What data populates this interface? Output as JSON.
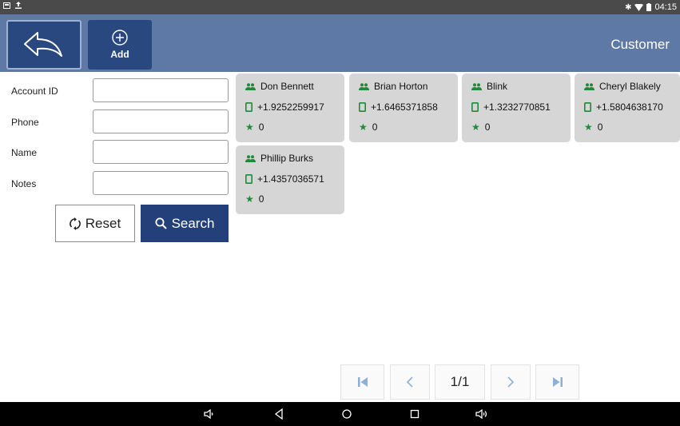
{
  "status": {
    "time": "04:15"
  },
  "header": {
    "add_label": "Add",
    "title": "Customer"
  },
  "form": {
    "fields": [
      {
        "label": "Account ID",
        "value": ""
      },
      {
        "label": "Phone",
        "value": ""
      },
      {
        "label": "Name",
        "value": ""
      },
      {
        "label": "Notes",
        "value": ""
      }
    ],
    "reset_label": "Reset",
    "search_label": "Search"
  },
  "customers": [
    {
      "name": "Don Bennett",
      "phone": "+1.9252259917",
      "points": "0"
    },
    {
      "name": "Brian Horton",
      "phone": "+1.6465371858",
      "points": "0"
    },
    {
      "name": "Blink",
      "phone": "+1.3232770851",
      "points": "0"
    },
    {
      "name": "Cheryl Blakely",
      "phone": "+1.5804638170",
      "points": "0"
    },
    {
      "name": "Phillip Burks",
      "phone": "+1.4357036571",
      "points": "0"
    }
  ],
  "pagination": {
    "page": "1/1"
  },
  "colors": {
    "header": "#5e79a6",
    "button": "#2a4880",
    "icon_green": "#1e8a3a",
    "card": "#d6d6d6"
  }
}
